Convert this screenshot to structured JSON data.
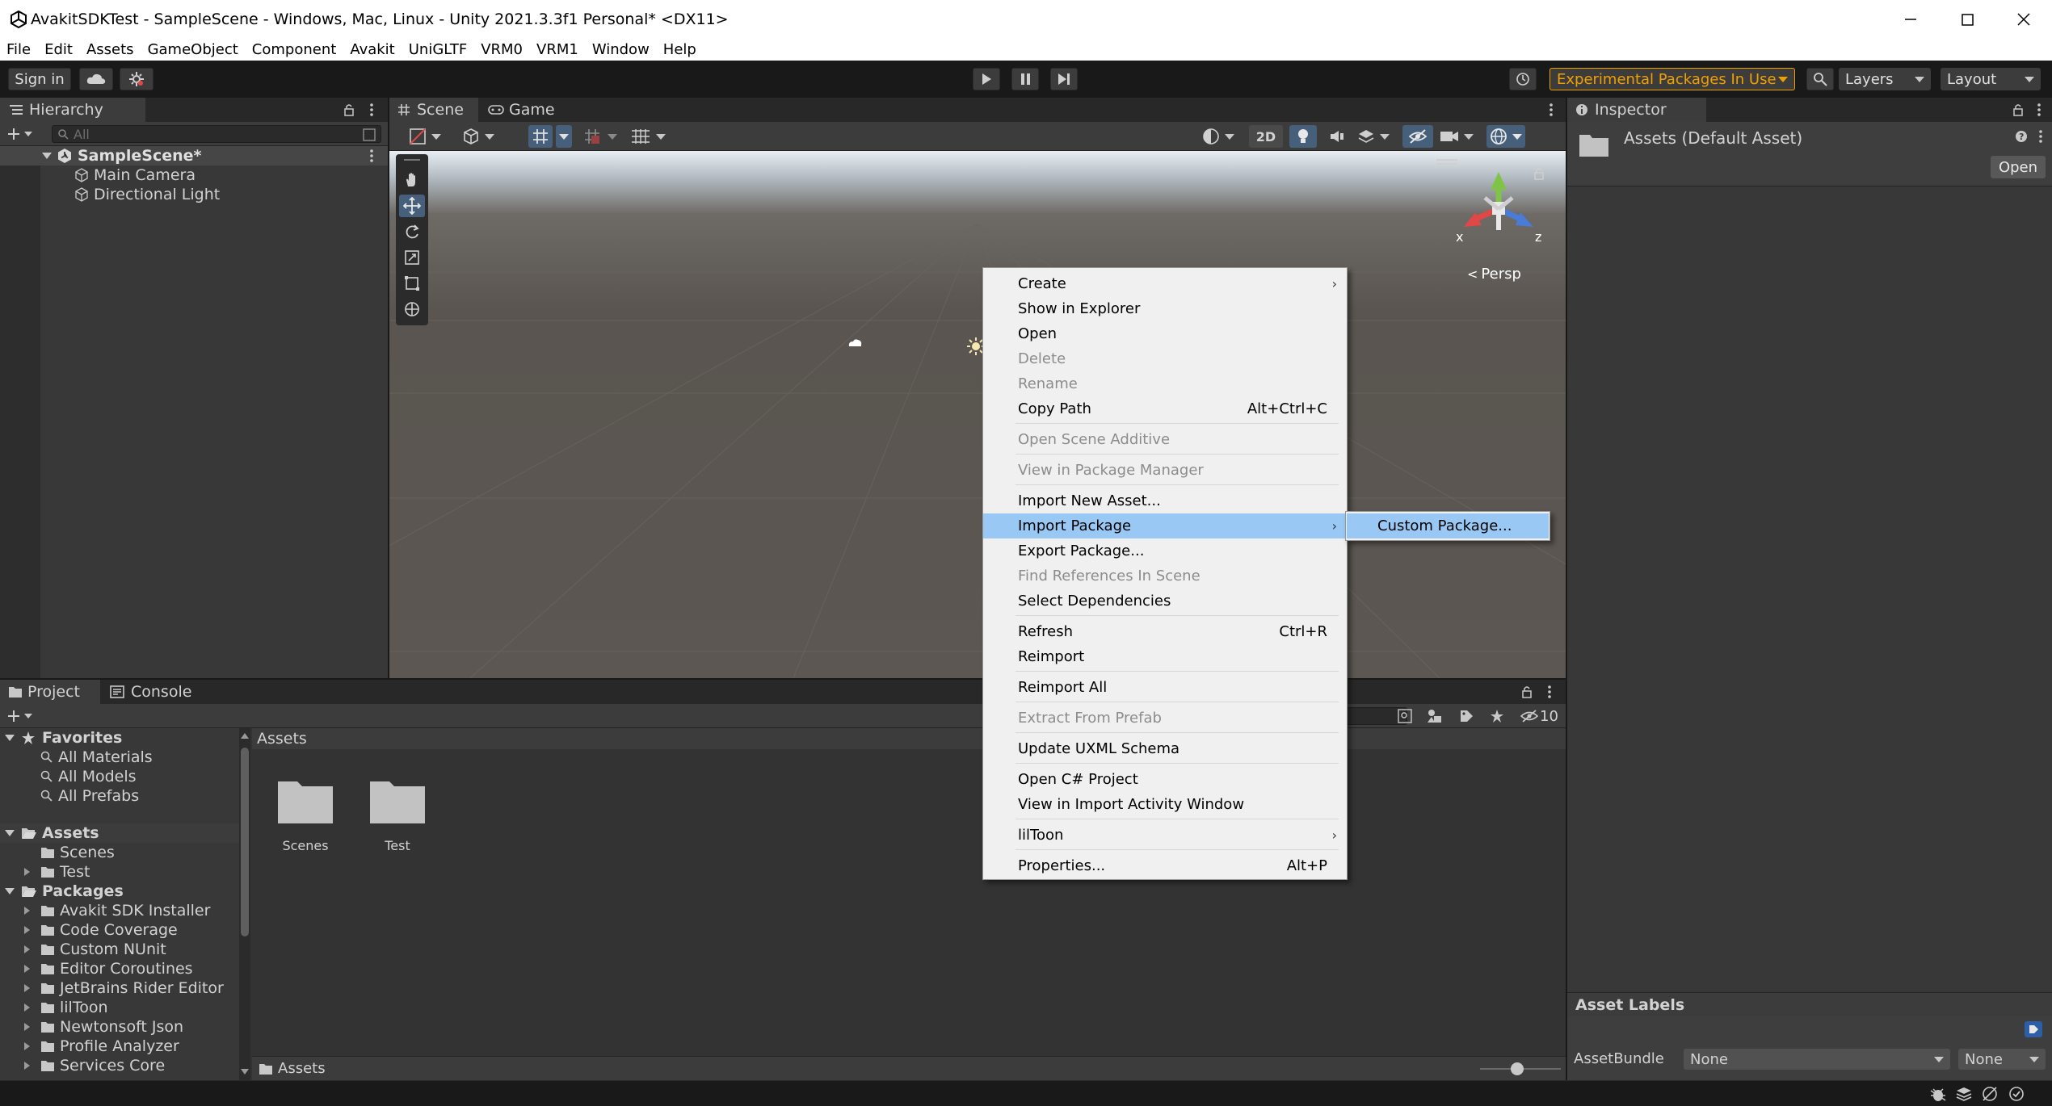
{
  "window": {
    "title": "AvakitSDKTest - SampleScene - Windows, Mac, Linux - Unity 2021.3.3f1 Personal* <DX11>"
  },
  "menubar": [
    "File",
    "Edit",
    "Assets",
    "GameObject",
    "Component",
    "Avakit",
    "UniGLTF",
    "VRM0",
    "VRM1",
    "Window",
    "Help"
  ],
  "toolbar": {
    "sign_in": "Sign in",
    "experimental": "Experimental Packages In Use",
    "layers": "Layers",
    "layout": "Layout"
  },
  "hierarchy": {
    "tab": "Hierarchy",
    "search_placeholder": "All",
    "scene": "SampleScene*",
    "items": [
      "Main Camera",
      "Directional Light"
    ]
  },
  "scene_view": {
    "tabs": [
      "Scene",
      "Game"
    ],
    "btn_2d": "2D",
    "persp": "Persp",
    "axis_x": "x",
    "axis_z": "z"
  },
  "inspector": {
    "tab": "Inspector",
    "asset_title": "Assets (Default Asset)",
    "open_button": "Open",
    "asset_labels": "Asset Labels",
    "assetbundle_label": "AssetBundle",
    "assetbundle_value": "None",
    "variant_value": "None"
  },
  "project": {
    "tabs": [
      "Project",
      "Console"
    ],
    "hidden_count": "10",
    "favorites_label": "Favorites",
    "favorites": [
      "All Materials",
      "All Models",
      "All Prefabs"
    ],
    "assets_label": "Assets",
    "assets": [
      "Scenes",
      "Test"
    ],
    "packages_label": "Packages",
    "packages": [
      "Avakit SDK Installer",
      "Code Coverage",
      "Custom NUnit",
      "Editor Coroutines",
      "JetBrains Rider Editor",
      "lilToon",
      "Newtonsoft Json",
      "Profile Analyzer",
      "Services Core"
    ],
    "breadcrumb": "Assets",
    "grid_items": [
      "Scenes",
      "Test"
    ],
    "footer_path": "Assets"
  },
  "context_menu": {
    "items": [
      {
        "label": "Create",
        "submenu": true
      },
      {
        "label": "Show in Explorer"
      },
      {
        "label": "Open"
      },
      {
        "label": "Delete",
        "disabled": true
      },
      {
        "label": "Rename",
        "disabled": true
      },
      {
        "label": "Copy Path",
        "shortcut": "Alt+Ctrl+C"
      },
      {
        "label": "Open Scene Additive",
        "disabled": true
      },
      {
        "label": "View in Package Manager",
        "disabled": true
      },
      {
        "label": "Import New Asset..."
      },
      {
        "label": "Import Package",
        "submenu": true,
        "highlighted": true
      },
      {
        "label": "Export Package..."
      },
      {
        "label": "Find References In Scene",
        "disabled": true
      },
      {
        "label": "Select Dependencies"
      },
      {
        "label": "Refresh",
        "shortcut": "Ctrl+R"
      },
      {
        "label": "Reimport"
      },
      {
        "label": "Reimport All"
      },
      {
        "label": "Extract From Prefab",
        "disabled": true
      },
      {
        "label": "Update UXML Schema"
      },
      {
        "label": "Open C# Project"
      },
      {
        "label": "View in Import Activity Window"
      },
      {
        "label": "lilToon",
        "submenu": true
      },
      {
        "label": "Properties...",
        "shortcut": "Alt+P"
      }
    ],
    "submenu_item": "Custom Package..."
  },
  "colors": {
    "accent_blue": "#99c8f5",
    "experimental_text": "#f0a000",
    "selected_tool": "#46607c"
  }
}
